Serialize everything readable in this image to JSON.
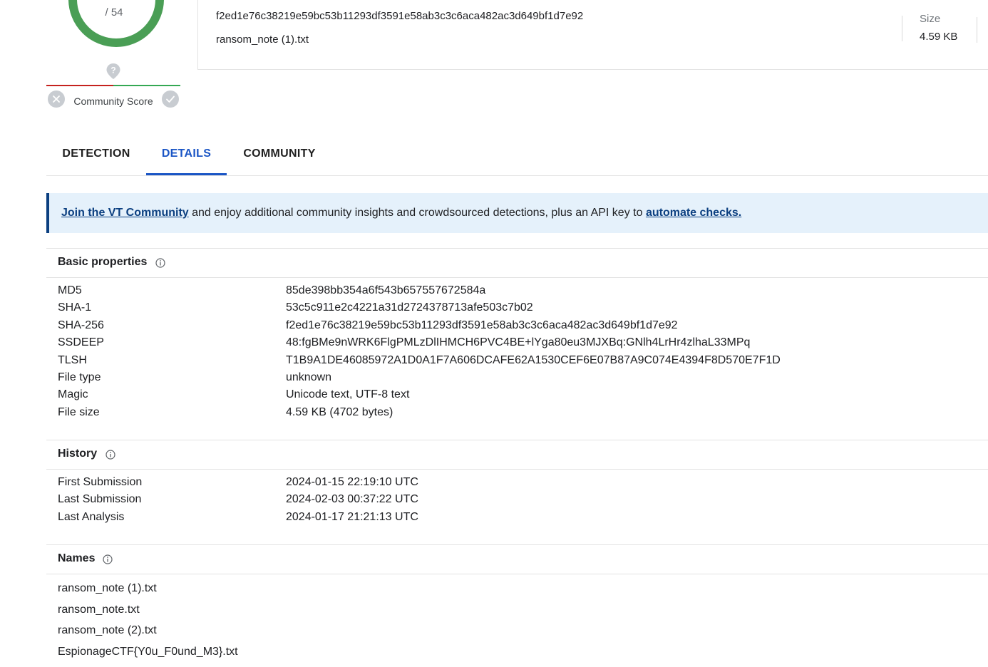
{
  "score": {
    "total_label": "/ 54"
  },
  "community_score": {
    "label": "Community Score",
    "pin_icon": "question-pin-icon",
    "down_icon": "x-icon",
    "up_icon": "check-icon"
  },
  "file": {
    "hash": "f2ed1e76c38219e59bc53b11293df3591e58ab3c3c6aca482ac3d649bf1d7e92",
    "name": "ransom_note (1).txt",
    "size_label": "Size",
    "size_value": "4.59 KB"
  },
  "tabs": [
    {
      "label": "DETECTION",
      "active": false
    },
    {
      "label": "DETAILS",
      "active": true
    },
    {
      "label": "COMMUNITY",
      "active": false
    }
  ],
  "banner": {
    "link1": "Join the VT Community",
    "text": " and enjoy additional community insights and crowdsourced detections, plus an API key to ",
    "link2": "automate checks."
  },
  "basic_properties": {
    "title": "Basic properties",
    "rows": [
      {
        "key": "MD5",
        "value": "85de398bb354a6f543b657557672584a"
      },
      {
        "key": "SHA-1",
        "value": "53c5c911e2c4221a31d2724378713afe503c7b02"
      },
      {
        "key": "SHA-256",
        "value": "f2ed1e76c38219e59bc53b11293df3591e58ab3c3c6aca482ac3d649bf1d7e92"
      },
      {
        "key": "SSDEEP",
        "value": "48:fgBMe9nWRK6FlgPMLzDlIHMCH6PVC4BE+lYga80eu3MJXBq:GNlh4LrHr4zlhaL33MPq"
      },
      {
        "key": "TLSH",
        "value": "T1B9A1DE46085972A1D0A1F7A606DCAFE62A1530CEF6E07B87A9C074E4394F8D570E7F1D"
      },
      {
        "key": "File type",
        "value": "unknown"
      },
      {
        "key": "Magic",
        "value": "Unicode text, UTF-8 text"
      },
      {
        "key": "File size",
        "value": "4.59 KB (4702 bytes)"
      }
    ]
  },
  "history": {
    "title": "History",
    "rows": [
      {
        "key": "First Submission",
        "value": "2024-01-15 22:19:10 UTC"
      },
      {
        "key": "Last Submission",
        "value": "2024-02-03 00:37:22 UTC"
      },
      {
        "key": "Last Analysis",
        "value": "2024-01-17 21:21:13 UTC"
      }
    ]
  },
  "names": {
    "title": "Names",
    "items": [
      "ransom_note (1).txt",
      "ransom_note.txt",
      "ransom_note (2).txt",
      "EspionageCTF{Y0u_F0und_M3}.txt"
    ]
  },
  "colors": {
    "accent": "#1a55c5",
    "banner_bg": "#e5f1fb",
    "banner_link": "#0b3f80",
    "gauge_green": "#4a9e55",
    "bar_red": "#c5221f",
    "bar_green": "#34a853"
  }
}
